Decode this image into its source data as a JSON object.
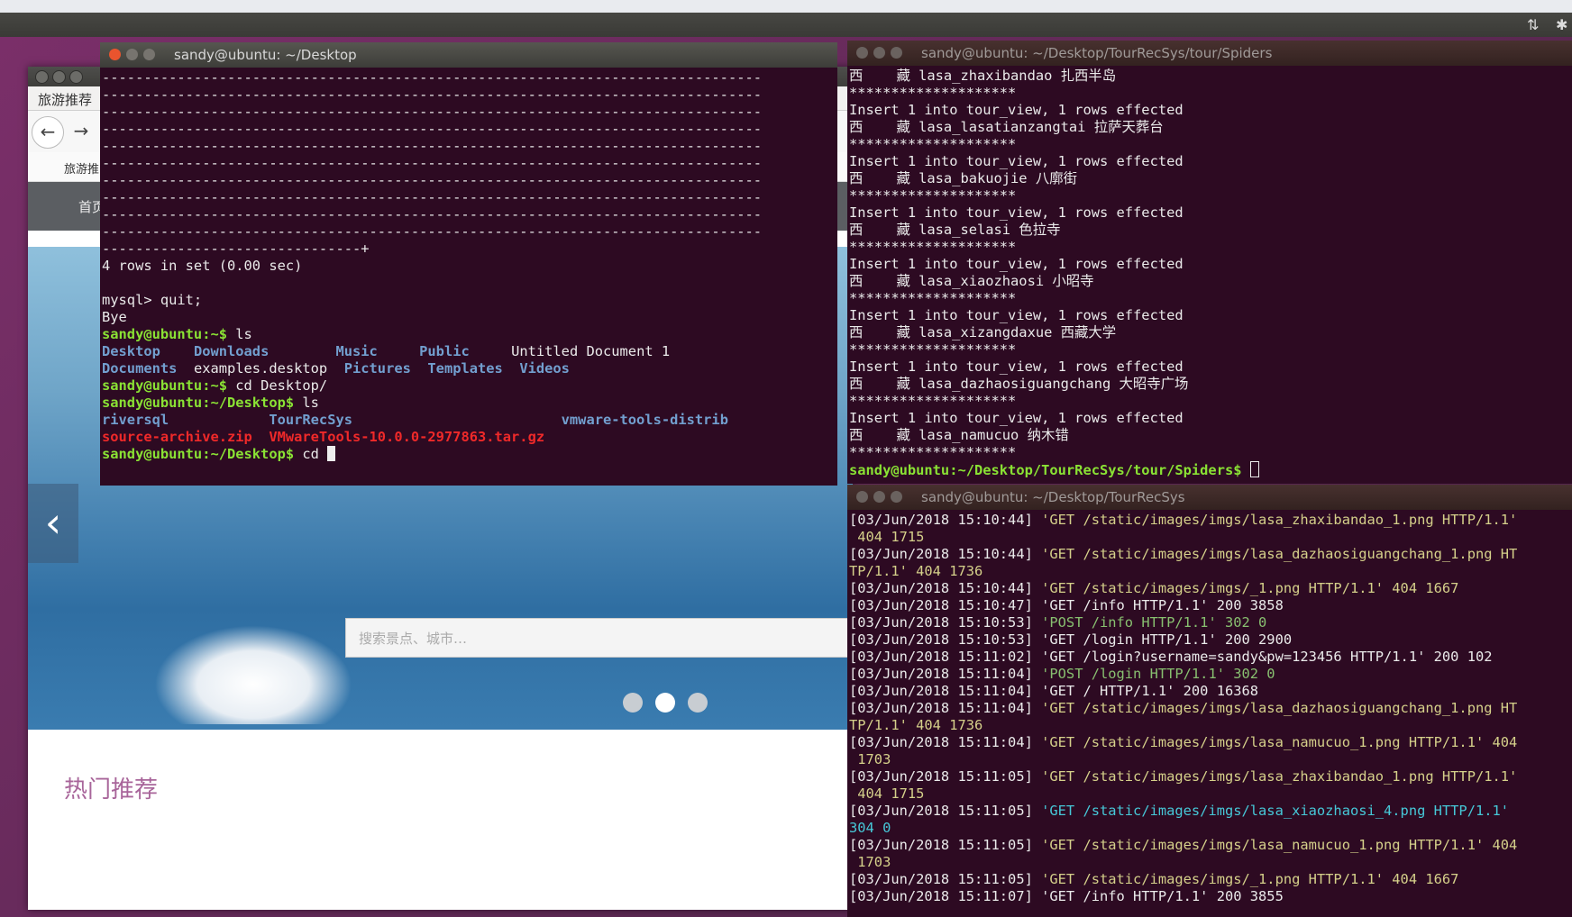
{
  "topbar": {
    "indicators": [
      "⇅",
      "✱"
    ]
  },
  "browser": {
    "tab_label": "旅游推荐",
    "bookmark_label": "旅游推",
    "menu_label": "首页",
    "search_placeholder": "搜索景点、城市…",
    "hot_heading": "热门推荐",
    "carousel": {
      "dots": 3,
      "active": 2
    }
  },
  "terminal1": {
    "title": "sandy@ubuntu: ~/Desktop",
    "lines": [
      {
        "t": "-------------------------------------------------------------------------------"
      },
      {
        "t": "-------------------------------------------------------------------------------"
      },
      {
        "t": "-------------------------------------------------------------------------------"
      },
      {
        "t": "-------------------------------------------------------------------------------"
      },
      {
        "t": "-------------------------------------------------------------------------------"
      },
      {
        "t": "-------------------------------------------------------------------------------"
      },
      {
        "t": "-------------------------------------------------------------------------------"
      },
      {
        "t": "-------------------------------------------------------------------------------"
      },
      {
        "t": "-------------------------------------------------------------------------------"
      },
      {
        "t": "-------------------------------------------------------------------------------"
      },
      {
        "t": "-------------------------------+"
      },
      {
        "t": "4 rows in set (0.00 sec)"
      },
      {
        "t": ""
      },
      {
        "t": "mysql> quit;"
      },
      {
        "t": "Bye"
      },
      {
        "prompt": "sandy@ubuntu:~$",
        "cmd": " ls"
      },
      {
        "ls": [
          [
            "Desktop",
            "pblue"
          ],
          [
            "    Downloads",
            "pblue"
          ],
          [
            "        Music",
            "pblue"
          ],
          [
            "     Public",
            "pblue"
          ],
          [
            "     Untitled Document 1",
            ""
          ]
        ]
      },
      {
        "ls": [
          [
            "Documents",
            "pblue"
          ],
          [
            "  examples.desktop",
            ""
          ],
          [
            "  Pictures",
            "pblue"
          ],
          [
            "  Templates",
            "pblue"
          ],
          [
            "  Videos",
            "pblue"
          ]
        ]
      },
      {
        "prompt": "sandy@ubuntu:~$",
        "cmd": " cd Desktop/"
      },
      {
        "prompt": "sandy@ubuntu:~/Desktop$",
        "cmd": " ls"
      },
      {
        "ls": [
          [
            "riversql",
            "pblue"
          ],
          [
            "            TourRecSys",
            "pblue"
          ],
          [
            "                         vmware-tools-distrib",
            "pblue"
          ]
        ]
      },
      {
        "ls": [
          [
            "source-archive.zip",
            "red"
          ],
          [
            "  VMwareTools-10.0.0-2977863.tar.gz",
            "red"
          ]
        ]
      },
      {
        "prompt": "sandy@ubuntu:~/Desktop$",
        "cmd": " cd ",
        "cursor": true
      }
    ]
  },
  "terminal2": {
    "title": "sandy@ubuntu: ~/Desktop/TourRecSys/tour/Spiders",
    "lines": [
      "西    藏 lasa_zhaxibandao 扎西半岛",
      "********************",
      "Insert 1 into tour_view, 1 rows effected",
      "西    藏 lasa_lasatianzangtai 拉萨天葬台",
      "********************",
      "Insert 1 into tour_view, 1 rows effected",
      "西    藏 lasa_bakuojie 八廓街",
      "********************",
      "Insert 1 into tour_view, 1 rows effected",
      "西    藏 lasa_selasi 色拉寺",
      "********************",
      "Insert 1 into tour_view, 1 rows effected",
      "西    藏 lasa_xiaozhaosi 小昭寺",
      "********************",
      "Insert 1 into tour_view, 1 rows effected",
      "西    藏 lasa_xizangdaxue 西藏大学",
      "********************",
      "Insert 1 into tour_view, 1 rows effected",
      "西    藏 lasa_dazhaosiguangchang 大昭寺广场",
      "********************",
      "Insert 1 into tour_view, 1 rows effected",
      "西    藏 lasa_namucuo 纳木错",
      "********************"
    ],
    "prompt": "sandy@ubuntu:~/Desktop/TourRecSys/tour/Spiders$"
  },
  "terminal3": {
    "title": "sandy@ubuntu: ~/Desktop/TourRecSys",
    "lines": [
      {
        "ts": "[03/Jun/2018 15:10:44]",
        "req": " 'GET /static/images/imgs/lasa_zhaxibandao_1.png HTTP/1.1'",
        "c": "yellow"
      },
      {
        "ts": "",
        "req": " 404 1715",
        "c": "yellow"
      },
      {
        "ts": "[03/Jun/2018 15:10:44]",
        "req": " 'GET /static/images/imgs/lasa_dazhaosiguangchang_1.png HT",
        "c": "yellow"
      },
      {
        "ts": "",
        "req": "TP/1.1' 404 1736",
        "c": "yellow"
      },
      {
        "ts": "[03/Jun/2018 15:10:44]",
        "req": " 'GET /static/images/imgs/_1.png HTTP/1.1' 404 1667",
        "c": "yellow"
      },
      {
        "ts": "[03/Jun/2018 15:10:47]",
        "req": " 'GET /info HTTP/1.1' 200 3858",
        "c": ""
      },
      {
        "ts": "[03/Jun/2018 15:10:53]",
        "req": " 'POST /info HTTP/1.1' 302 0",
        "c": "green2"
      },
      {
        "ts": "[03/Jun/2018 15:10:53]",
        "req": " 'GET /login HTTP/1.1' 200 2900",
        "c": ""
      },
      {
        "ts": "[03/Jun/2018 15:11:02]",
        "req": " 'GET /login?username=sandy&pw=123456 HTTP/1.1' 200 102",
        "c": ""
      },
      {
        "ts": "[03/Jun/2018 15:11:04]",
        "req": " 'POST /login HTTP/1.1' 302 0",
        "c": "green2"
      },
      {
        "ts": "[03/Jun/2018 15:11:04]",
        "req": " 'GET / HTTP/1.1' 200 16368",
        "c": ""
      },
      {
        "ts": "[03/Jun/2018 15:11:04]",
        "req": " 'GET /static/images/imgs/lasa_dazhaosiguangchang_1.png HT",
        "c": "yellow"
      },
      {
        "ts": "",
        "req": "TP/1.1' 404 1736",
        "c": "yellow"
      },
      {
        "ts": "[03/Jun/2018 15:11:04]",
        "req": " 'GET /static/images/imgs/lasa_namucuo_1.png HTTP/1.1' 404",
        "c": "yellow"
      },
      {
        "ts": "",
        "req": " 1703",
        "c": "yellow"
      },
      {
        "ts": "[03/Jun/2018 15:11:05]",
        "req": " 'GET /static/images/imgs/lasa_zhaxibandao_1.png HTTP/1.1'",
        "c": "yellow"
      },
      {
        "ts": "",
        "req": " 404 1715",
        "c": "yellow"
      },
      {
        "ts": "[03/Jun/2018 15:11:05]",
        "req": " 'GET /static/images/imgs/lasa_xiaozhaosi_4.png HTTP/1.1'",
        "c": "cyan"
      },
      {
        "ts": "",
        "req": "304 0",
        "c": "cyan"
      },
      {
        "ts": "[03/Jun/2018 15:11:05]",
        "req": " 'GET /static/images/imgs/lasa_namucuo_1.png HTTP/1.1' 404",
        "c": "yellow"
      },
      {
        "ts": "",
        "req": " 1703",
        "c": "yellow"
      },
      {
        "ts": "[03/Jun/2018 15:11:05]",
        "req": " 'GET /static/images/imgs/_1.png HTTP/1.1' 404 1667",
        "c": "yellow"
      },
      {
        "ts": "[03/Jun/2018 15:11:07]",
        "req": " 'GET /info HTTP/1.1' 200 3855",
        "c": ""
      }
    ]
  }
}
